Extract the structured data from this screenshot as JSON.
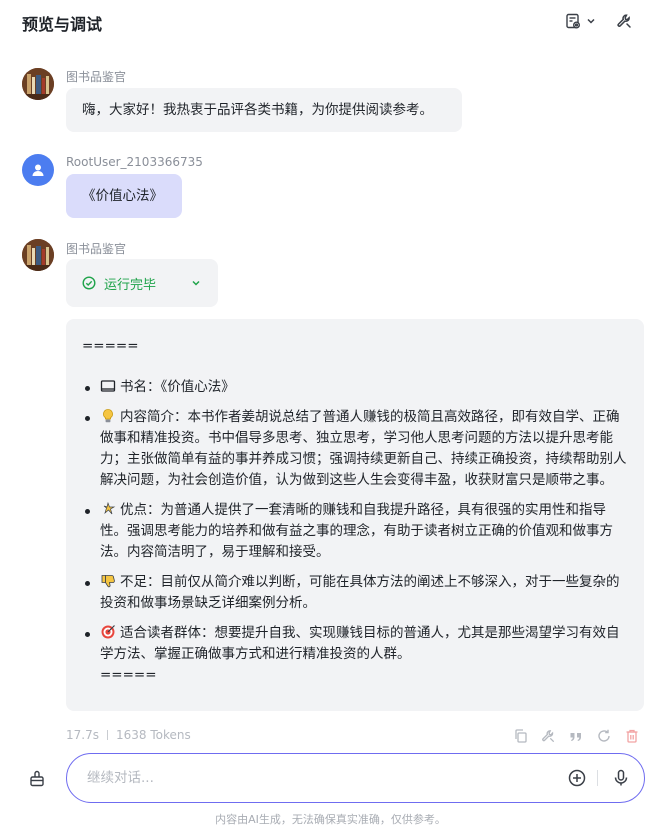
{
  "header": {
    "title": "预览与调试"
  },
  "messages": [
    {
      "sender": "图书品鉴官",
      "text": "嗨，大家好！我热衷于品评各类书籍，为你提供阅读参考。"
    },
    {
      "sender": "RootUser_2103366735",
      "text": "《价值心法》"
    },
    {
      "sender": "图书品鉴官"
    }
  ],
  "status": {
    "label": "运行完毕"
  },
  "answer": {
    "sep_top": "=====",
    "items": [
      {
        "icon": "book-icon",
        "text": "书名：《价值心法》"
      },
      {
        "icon": "lightbulb-icon",
        "text": "内容简介：本书作者姜胡说总结了普通人赚钱的极简且高效路径，即有效自学、正确做事和精准投资。书中倡导多思考、独立思考，学习他人思考问题的方法以提升思考能力；主张做简单有益的事并养成习惯；强调持续更新自己、持续正确投资，持续帮助别人解决问题，为社会创造价值，认为做到这些人生会变得丰盈，收获财富只是顺带之事。"
      },
      {
        "icon": "sparkle-icon",
        "text": "优点：为普通人提供了一套清晰的赚钱和自我提升路径，具有很强的实用性和指导性。强调思考能力的培养和做有益之事的理念，有助于读者树立正确的价值观和做事方法。内容简洁明了，易于理解和接受。"
      },
      {
        "icon": "thumbs-down-icon",
        "text": "不足：目前仅从简介难以判断，可能在具体方法的阐述上不够深入，对于一些复杂的投资和做事场景缺乏详细案例分析。"
      },
      {
        "icon": "target-icon",
        "text": "适合读者群体：想要提升自我、实现赚钱目标的普通人，尤其是那些渴望学习有效自学方法、掌握正确做事方式和进行精准投资的人群。"
      }
    ],
    "sep_bottom": "====="
  },
  "meta": {
    "time": "17.7s",
    "tokens": "1638 Tokens"
  },
  "input": {
    "placeholder": "继续对话..."
  },
  "footer": {
    "text": "内容由AI生成，无法确保真实准确，仅供参考。"
  },
  "colors": {
    "accent": "#6f6cf0",
    "success": "#1fa34a",
    "user_bubble": "#dadcfb",
    "bot_bubble": "#f2f3f5"
  }
}
